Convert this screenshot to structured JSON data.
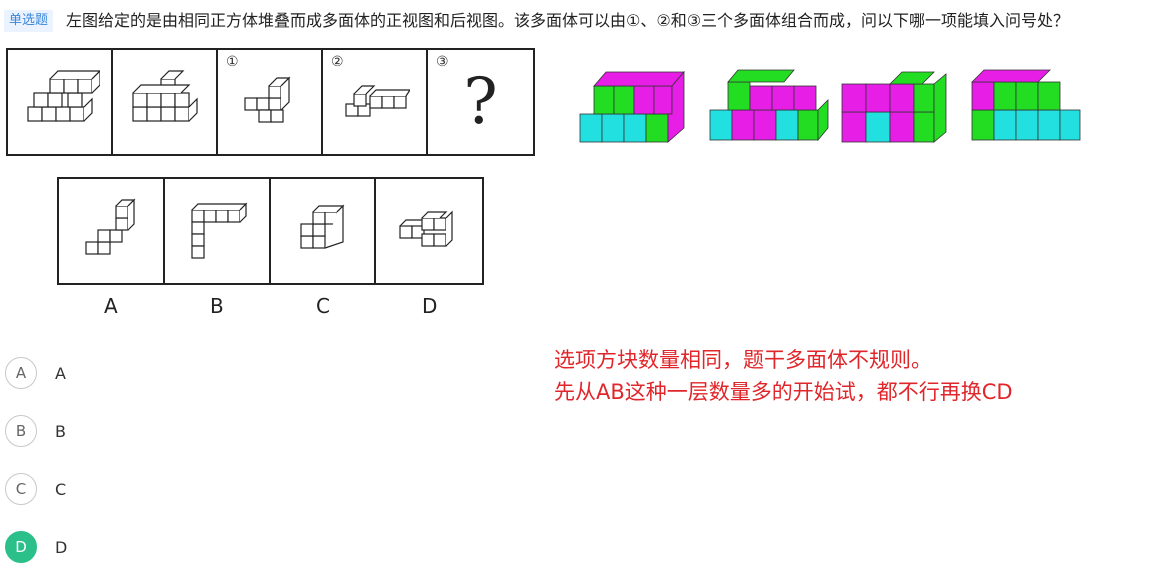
{
  "question": {
    "tag": "单选题",
    "text": "左图给定的是由相同正方体堆叠而成多面体的正视图和后视图。该多面体可以由①、②和③三个多面体组合而成，问以下哪一项能填入问号处？"
  },
  "figure": {
    "row1_labels": [
      "",
      "",
      "①",
      "②",
      "③"
    ],
    "question_mark": "?",
    "option_letters": [
      "A",
      "B",
      "C",
      "D"
    ],
    "colors": {
      "green": "#22dd22",
      "magenta": "#e61ee6",
      "cyan": "#22e0e0"
    }
  },
  "note": {
    "line1": "选项方块数量相同，题干多面体不规则。",
    "line2": "先从AB这种一层数量多的开始试，都不行再换CD"
  },
  "choices": [
    {
      "letter": "A",
      "label": "A",
      "selected": false
    },
    {
      "letter": "B",
      "label": "B",
      "selected": false
    },
    {
      "letter": "C",
      "label": "C",
      "selected": false
    },
    {
      "letter": "D",
      "label": "D",
      "selected": true
    }
  ],
  "colors": {
    "accent": "#2bbf8a",
    "note": "#e0262a",
    "tag_bg": "#eaf3ff",
    "tag_fg": "#3a86d8"
  }
}
